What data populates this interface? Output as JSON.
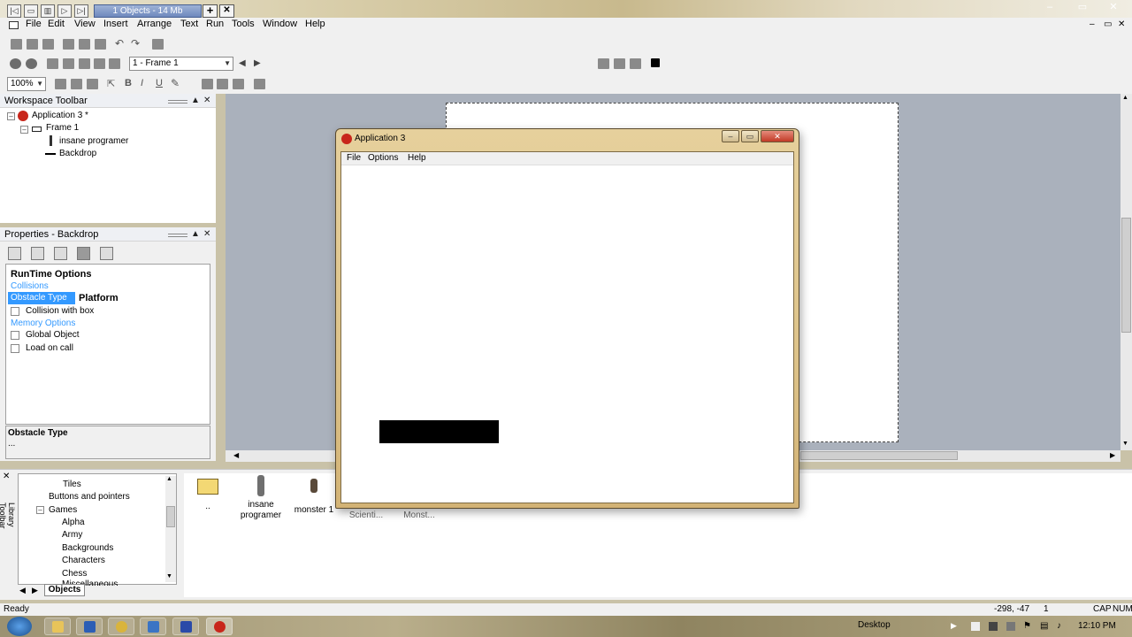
{
  "titlebar": {
    "object_counter": "1 Objects - 14 Mb",
    "add_symbol": "+",
    "close_symbol": "✕"
  },
  "window_controls": {
    "minimize": "–",
    "restore": "▭",
    "close": "✕"
  },
  "menubar": {
    "items": [
      "File",
      "Edit",
      "View",
      "Insert",
      "Arrange",
      "Text",
      "Run",
      "Tools",
      "Window",
      "Help"
    ]
  },
  "toolbar": {
    "frame_select": "1 - Frame 1",
    "zoom_select": "100%"
  },
  "workspace": {
    "title": "Workspace Toolbar",
    "tree": {
      "application": "Application 3 *",
      "frame": "Frame 1",
      "objects": [
        "insane programer",
        "Backdrop"
      ]
    }
  },
  "properties": {
    "title": "Properties - Backdrop",
    "section_runtime": "RunTime Options",
    "section_collisions": "Collisions",
    "obstacle_type_label": "Obstacle Type",
    "obstacle_type_value": "Platform",
    "collision_with_box": "Collision with box",
    "section_memory": "Memory Options",
    "global_object": "Global Object",
    "load_on_call": "Load on call",
    "description_title": "Obstacle Type",
    "description_text": "..."
  },
  "library": {
    "side_label": "Library Toolbar",
    "tree": [
      "Tiles",
      "Buttons and pointers",
      "Games",
      "Alpha",
      "Army",
      "Backgrounds",
      "Characters",
      "Chess",
      "Miscellaneous"
    ],
    "tab": "Objects",
    "items": [
      "..",
      "insane programer",
      "monster 1",
      "Scienti...",
      "Monst..."
    ]
  },
  "app_window": {
    "title": "Application 3",
    "menu": [
      "File",
      "Options",
      "Help"
    ]
  },
  "statusbar": {
    "status": "Ready",
    "coords": "-298, -47",
    "layer": "1",
    "caps": "CAP",
    "num": "NUM"
  },
  "taskbar": {
    "desktop_label": "Desktop",
    "clock": "12:10 PM"
  },
  "colors": {
    "selection": "#3399ff",
    "section_text": "#3399ff",
    "editor_bg": "#aab1bc",
    "black_bar": "#000000"
  }
}
